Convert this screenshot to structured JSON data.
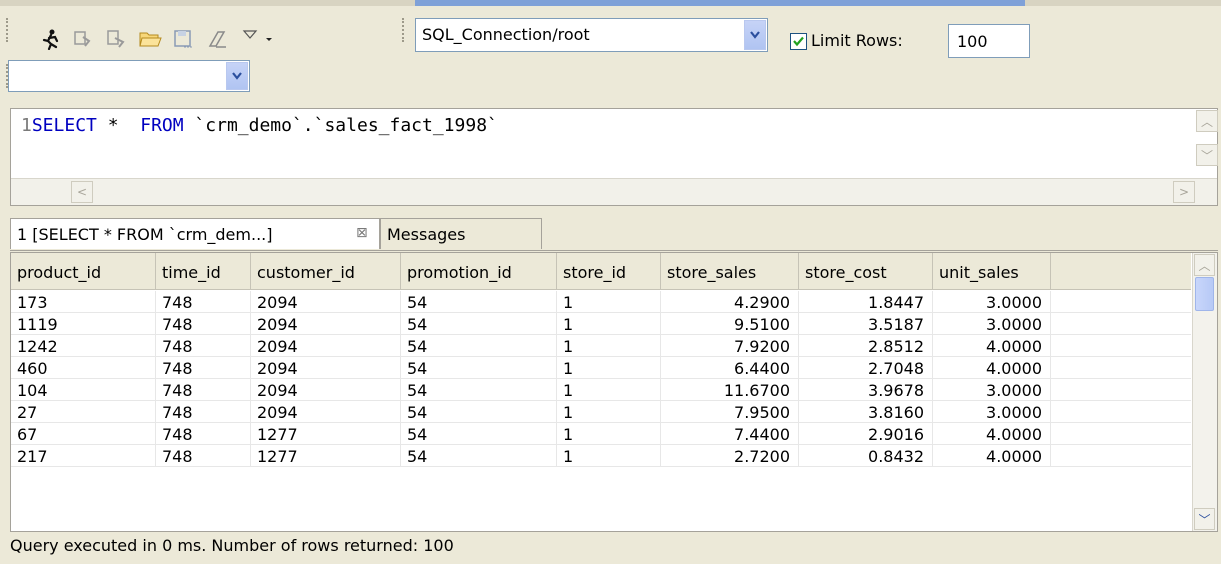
{
  "toolbar": {
    "connection_value": "SQL_Connection/root",
    "limit_rows_checked": true,
    "limit_rows_label": "Limit Rows:",
    "limit_rows_value": "100",
    "secondary_combo_value": "",
    "icons": [
      "run-icon",
      "run-selected-icon",
      "run-explain-icon",
      "open-folder-icon",
      "save-icon",
      "clear-icon",
      "view-menu-icon",
      "dropdown-icon"
    ]
  },
  "editor": {
    "line_number": "1",
    "kw_select": "SELECT",
    "star": " * ",
    "kw_from": "FROM",
    "table_ref": " `crm_demo`.`sales_fact_1998`"
  },
  "tabs": [
    {
      "label": "1 [SELECT * FROM `crm_dem...]",
      "active": true,
      "closable": true
    },
    {
      "label": "Messages",
      "active": false,
      "closable": false
    }
  ],
  "table": {
    "columns": [
      "product_id",
      "time_id",
      "customer_id",
      "promotion_id",
      "store_id",
      "store_sales",
      "store_cost",
      "unit_sales"
    ],
    "rows": [
      [
        "173",
        "748",
        "2094",
        "54",
        "1",
        "4.2900",
        "1.8447",
        "3.0000"
      ],
      [
        "1119",
        "748",
        "2094",
        "54",
        "1",
        "9.5100",
        "3.5187",
        "3.0000"
      ],
      [
        "1242",
        "748",
        "2094",
        "54",
        "1",
        "7.9200",
        "2.8512",
        "4.0000"
      ],
      [
        "460",
        "748",
        "2094",
        "54",
        "1",
        "6.4400",
        "2.7048",
        "4.0000"
      ],
      [
        "104",
        "748",
        "2094",
        "54",
        "1",
        "11.6700",
        "3.9678",
        "3.0000"
      ],
      [
        "27",
        "748",
        "2094",
        "54",
        "1",
        "7.9500",
        "3.8160",
        "3.0000"
      ],
      [
        "67",
        "748",
        "1277",
        "54",
        "1",
        "7.4400",
        "2.9016",
        "4.0000"
      ],
      [
        "217",
        "748",
        "1277",
        "54",
        "1",
        "2.7200",
        "0.8432",
        "4.0000"
      ]
    ]
  },
  "status": {
    "text": "Query executed in 0 ms.  Number of rows returned: 100"
  },
  "colors": {
    "background": "#ece9d8",
    "keyword": "#0000c0",
    "highlight_bar": "#7fa1d8"
  }
}
